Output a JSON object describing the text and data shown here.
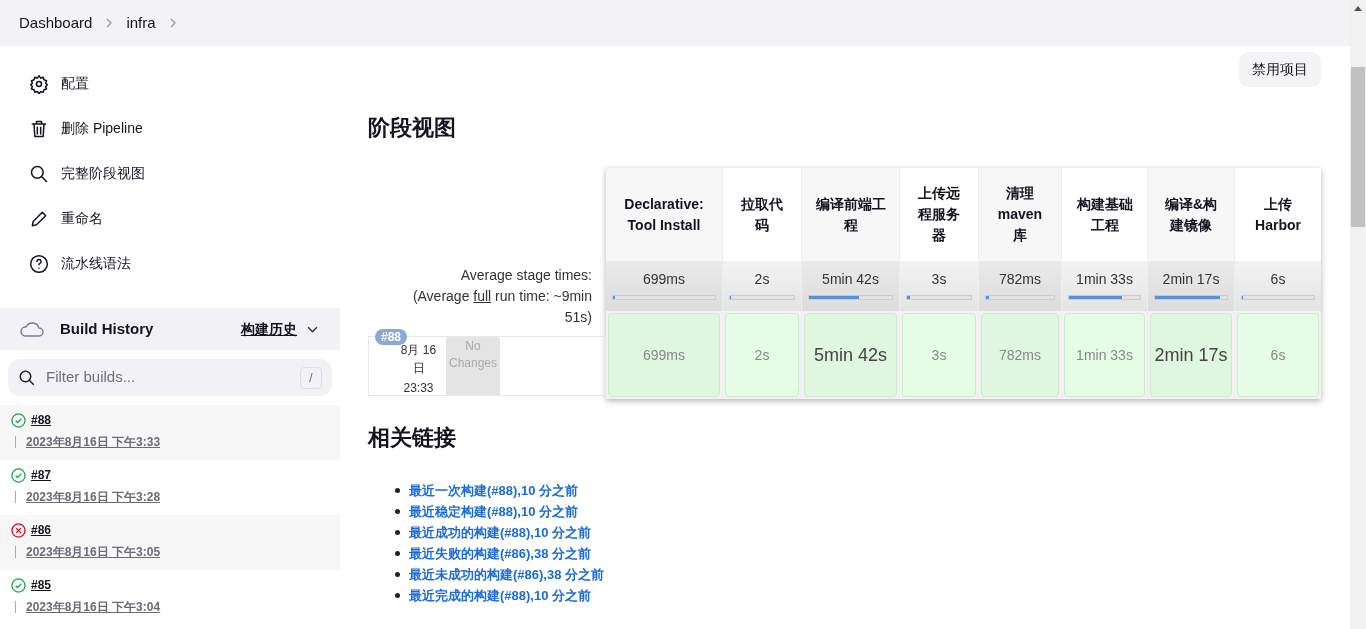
{
  "breadcrumbs": [
    {
      "label": "Dashboard"
    },
    {
      "label": "infra"
    }
  ],
  "sidebar": {
    "items": [
      {
        "label": "配置"
      },
      {
        "label": "删除 Pipeline"
      },
      {
        "label": "完整阶段视图"
      },
      {
        "label": "重命名"
      },
      {
        "label": "流水线语法"
      }
    ]
  },
  "build_history": {
    "title": "Build History",
    "link": "构建历史",
    "filter_placeholder": "Filter builds...",
    "shortcut": "/",
    "builds": [
      {
        "number": "#88",
        "date": "2023年8月16日 下午3:33",
        "kind": "success"
      },
      {
        "number": "#87",
        "date": "2023年8月16日 下午3:28",
        "kind": "success"
      },
      {
        "number": "#86",
        "date": "2023年8月16日 下午3:05",
        "kind": "failed"
      },
      {
        "number": "#85",
        "date": "2023年8月16日 下午3:04",
        "kind": "success"
      }
    ]
  },
  "disable_button": "禁用项目",
  "stage_view": {
    "title": "阶段视图",
    "avg_label": "Average stage times:",
    "avg_full_prefix": "(Average ",
    "avg_full_link": "full",
    "avg_full_suffix": " run time: ~9min 51s)",
    "stages": [
      {
        "name": "Declarative: Tool Install",
        "avg": "699ms",
        "level": 0.02
      },
      {
        "name": "拉取代码",
        "avg": "2s",
        "level": 0.02
      },
      {
        "name": "编译前端工程",
        "avg": "5min 42s",
        "level": 0.6
      },
      {
        "name": "上传远程服务器",
        "avg": "3s",
        "level": 0.05
      },
      {
        "name": "清理 maven 库",
        "avg": "782ms",
        "level": 0.04
      },
      {
        "name": "构建基础工程",
        "avg": "1min 33s",
        "level": 0.75
      },
      {
        "name": "编译&构建镜像",
        "avg": "2min 17s",
        "level": 0.9
      },
      {
        "name": "上传 Harbor",
        "avg": "6s",
        "level": 0.02
      }
    ],
    "build": {
      "badge": "#88",
      "date": "8月 16 日",
      "time": "23:33",
      "changes": "No Changes",
      "cells": [
        {
          "time": "699ms",
          "long": false
        },
        {
          "time": "2s",
          "long": false
        },
        {
          "time": "5min 42s",
          "long": true
        },
        {
          "time": "3s",
          "long": false
        },
        {
          "time": "782ms",
          "long": false
        },
        {
          "time": "1min 33s",
          "long": false
        },
        {
          "time": "2min 17s",
          "long": true
        },
        {
          "time": "6s",
          "long": false
        }
      ]
    }
  },
  "related": {
    "title": "相关链接",
    "links": [
      "最近一次构建(#88),10 分之前",
      "最近稳定构建(#88),10 分之前",
      "最近成功的构建(#88),10 分之前",
      "最近失败的构建(#86),38 分之前",
      "最近未成功的构建(#86),38 分之前",
      "最近完成的构建(#88),10 分之前"
    ]
  }
}
